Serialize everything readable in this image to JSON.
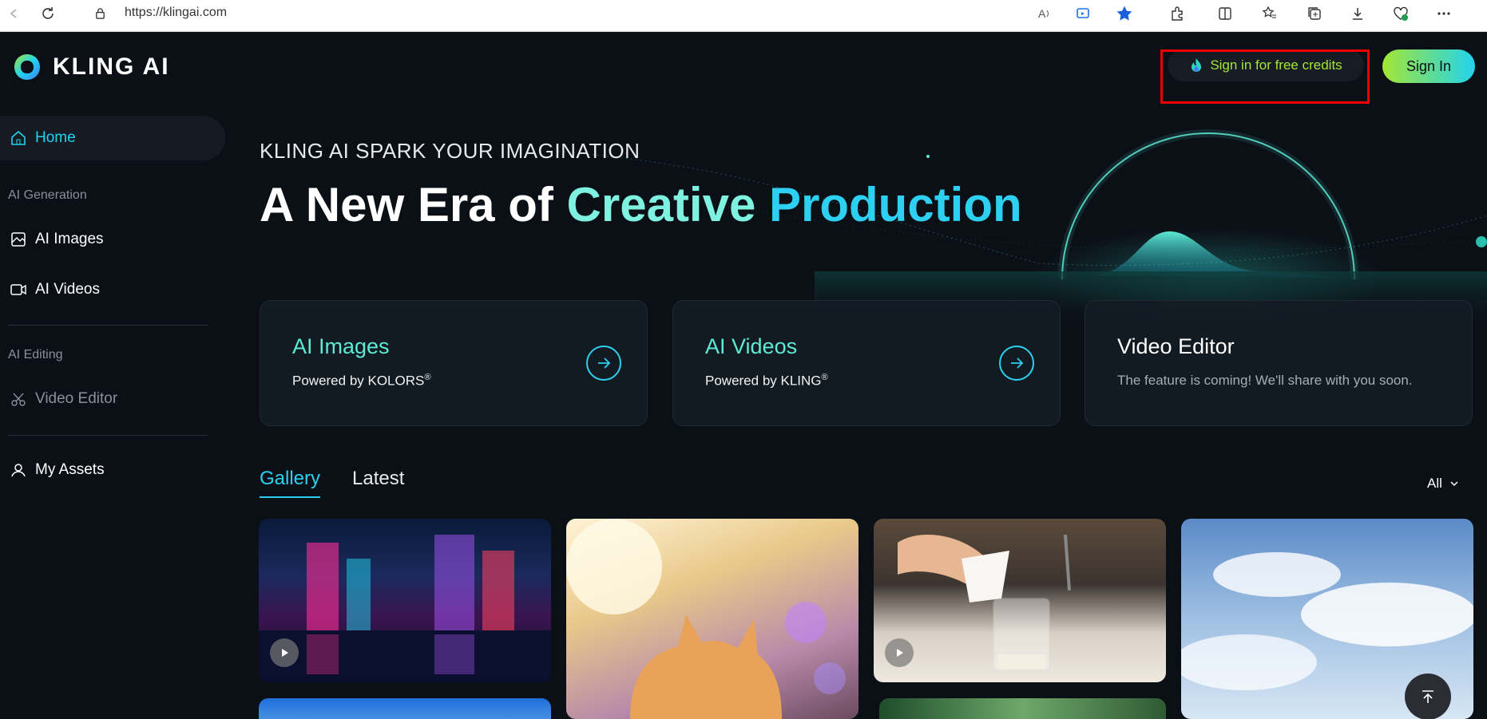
{
  "browser": {
    "url": "https://klingai.com",
    "icons": [
      "back-icon",
      "refresh-icon",
      "lock-icon",
      "read-aloud-icon",
      "immersive-reader-icon",
      "favorite-star-icon",
      "extensions-icon",
      "split-screen-icon",
      "favorites-icon",
      "collections-icon",
      "downloads-icon",
      "health-icon",
      "more-icon"
    ]
  },
  "brand": {
    "logo_text": "KLING AI",
    "accent": "#22d3ee",
    "lime": "#a3e635"
  },
  "header": {
    "credits_label": "Sign in for free credits",
    "signin_label": "Sign In"
  },
  "sidebar": {
    "home": "Home",
    "section_generation": "AI Generation",
    "ai_images": "AI Images",
    "ai_videos": "AI Videos",
    "section_editing": "AI Editing",
    "video_editor": "Video Editor",
    "my_assets": "My Assets"
  },
  "hero": {
    "eyebrow": "KLING AI SPARK YOUR IMAGINATION",
    "headline_part1": "A New Era of",
    "headline_part2": "Creative",
    "headline_part3": "Production"
  },
  "cards": [
    {
      "title": "AI Images",
      "subtitle": "Powered by KOLORS",
      "mark": "®"
    },
    {
      "title": "AI Videos",
      "subtitle": "Powered by KLING",
      "mark": "®"
    },
    {
      "title": "Video Editor",
      "subtitle": "The feature is coming! We'll share with you soon."
    }
  ],
  "gallery": {
    "tabs": [
      "Gallery",
      "Latest"
    ],
    "filter": "All",
    "items": [
      {
        "name": "neon-city-night",
        "type": "video"
      },
      {
        "name": "cat-in-flowers",
        "type": "image"
      },
      {
        "name": "pouring-milk-glass",
        "type": "video"
      },
      {
        "name": "sky-clouds",
        "type": "image"
      }
    ]
  }
}
